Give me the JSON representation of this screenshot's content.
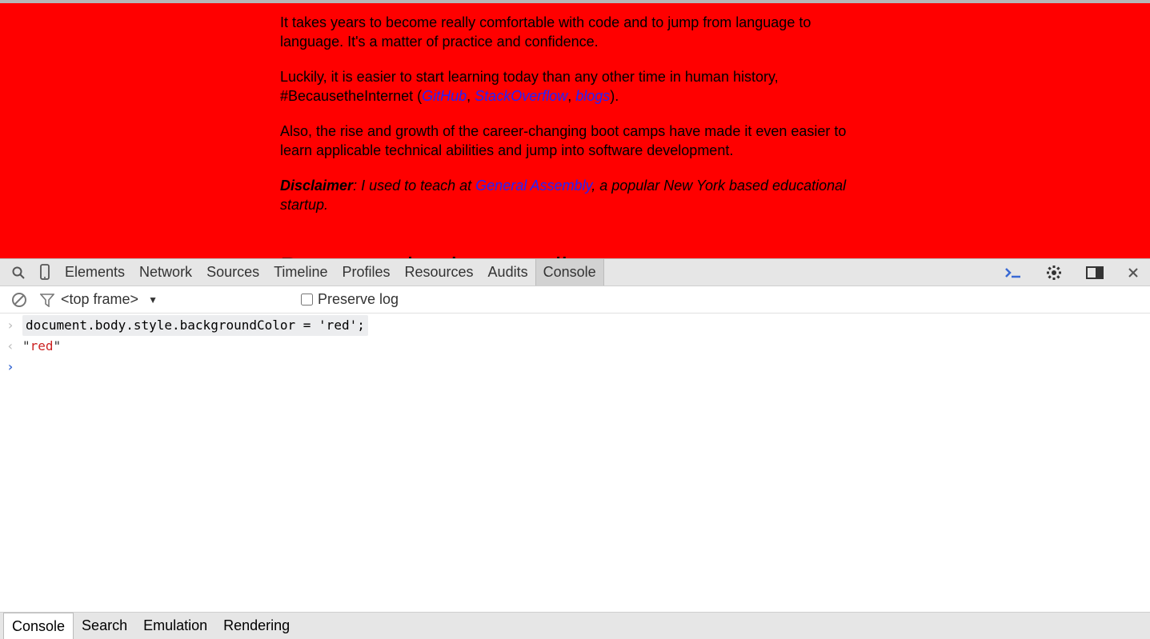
{
  "colors": {
    "page_bg": "red",
    "link": "#2222ff",
    "status_red": "#c22"
  },
  "page": {
    "p1": "It takes years to become really comfortable with code and to jump from language to language. It's a matter of practice and confidence.",
    "p2a": "Luckily, it is easier to start learning today than any other time in human history, #BecausetheInternet (",
    "p2_link1": "GitHub",
    "p2b": ", ",
    "p2_link2": "StackOverflow",
    "p2c": ", ",
    "p2_link3": "blogs",
    "p2d": ").",
    "p3": "Also, the rise and growth of the career-changing boot camps have made it even easier to learn applicable technical abilities and jump into software development.",
    "disclaimer_label": "Disclaimer",
    "disclaimer_a": ": I used to teach at ",
    "disclaimer_link": "General Assembly",
    "disclaimer_b": ", a popular New York based educational startup.",
    "h2": "Programming is rewarding"
  },
  "tabs": [
    "Elements",
    "Network",
    "Sources",
    "Timeline",
    "Profiles",
    "Resources",
    "Audits",
    "Console"
  ],
  "active_tab": "Console",
  "bar2": {
    "frame_selector": "<top frame>",
    "preserve_log_label": "Preserve log"
  },
  "console": {
    "input": "document.body.style.backgroundColor = 'red';",
    "output_quote": "\"",
    "output_value": "red"
  },
  "drawer": [
    "Console",
    "Search",
    "Emulation",
    "Rendering"
  ],
  "drawer_active": "Console"
}
